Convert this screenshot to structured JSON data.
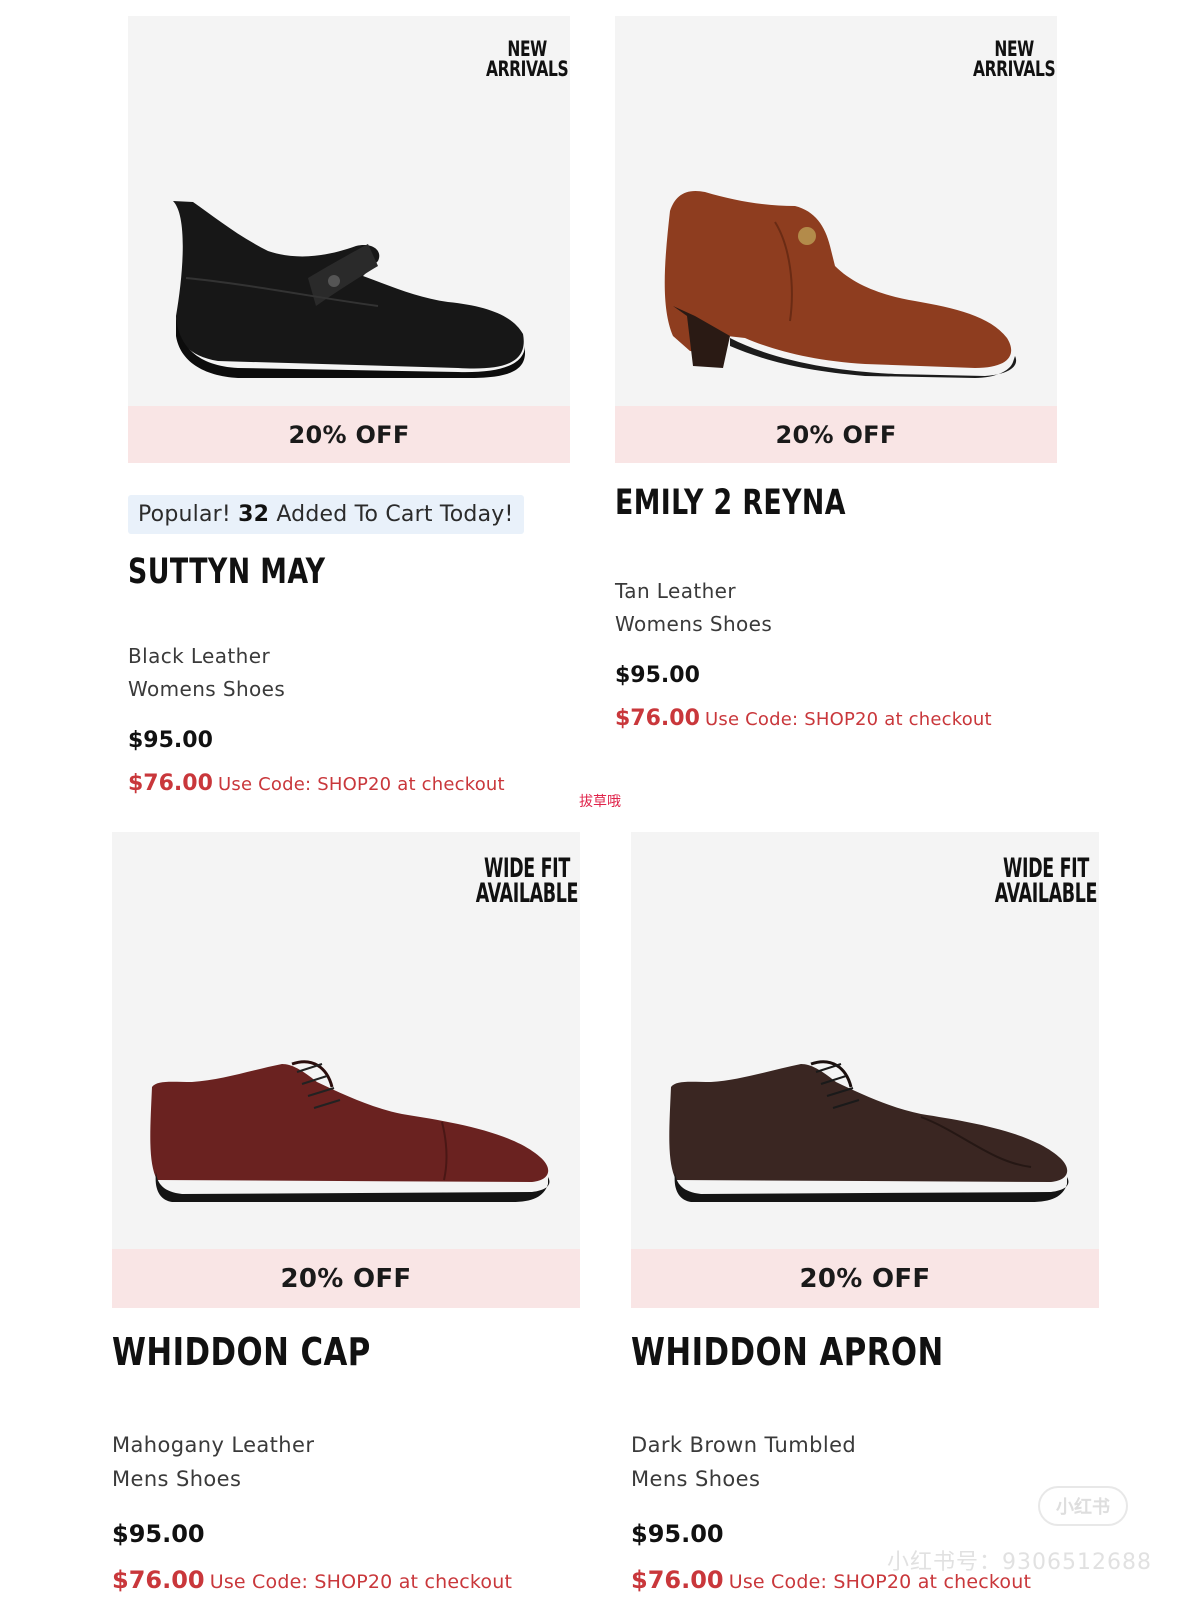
{
  "products": [
    {
      "corner_badge": [
        "NEW",
        "ARRIVALS"
      ],
      "discount": "20% OFF",
      "popular": {
        "prefix": "Popular! ",
        "count": "32",
        "suffix": " Added To Cart Today!"
      },
      "name": "SUTTYN MAY",
      "color": "Black Leather",
      "category": "Womens Shoes",
      "price": "$95.00",
      "sale_price": "$76.00",
      "promo": "Use Code: SHOP20 at checkout",
      "shoe_icon": "mary-jane-wedge-black"
    },
    {
      "corner_badge": [
        "NEW",
        "ARRIVALS"
      ],
      "discount": "20% OFF",
      "name": "EMILY 2 REYNA",
      "color": "Tan Leather",
      "category": "Womens Shoes",
      "price": "$95.00",
      "sale_price": "$76.00",
      "promo": "Use Code: SHOP20 at checkout",
      "shoe_icon": "heeled-bootie-tan"
    },
    {
      "corner_badge": [
        "WIDE FIT",
        "AVAILABLE"
      ],
      "discount": "20% OFF",
      "name": "WHIDDON CAP",
      "color": "Mahogany Leather",
      "category": "Mens Shoes",
      "price": "$95.00",
      "sale_price": "$76.00",
      "promo": "Use Code: SHOP20 at checkout",
      "shoe_icon": "oxford-cap-toe-mahogany"
    },
    {
      "corner_badge": [
        "WIDE FIT",
        "AVAILABLE"
      ],
      "discount": "20% OFF",
      "name": "WHIDDON APRON",
      "color": "Dark Brown Tumbled",
      "category": "Mens Shoes",
      "price": "$95.00",
      "sale_price": "$76.00",
      "promo": "Use Code: SHOP20 at checkout",
      "shoe_icon": "oxford-apron-dark-brown"
    }
  ],
  "watermarks": {
    "center": "拔草哦",
    "bottom": "小红书号：9306512688",
    "logo": "小红书"
  },
  "colors": {
    "discount_bar_bg": "#f9e5e5",
    "sale_red": "#c9373b",
    "image_bg": "#f4f4f4",
    "popular_pill_bg": "#e9f1fa"
  }
}
